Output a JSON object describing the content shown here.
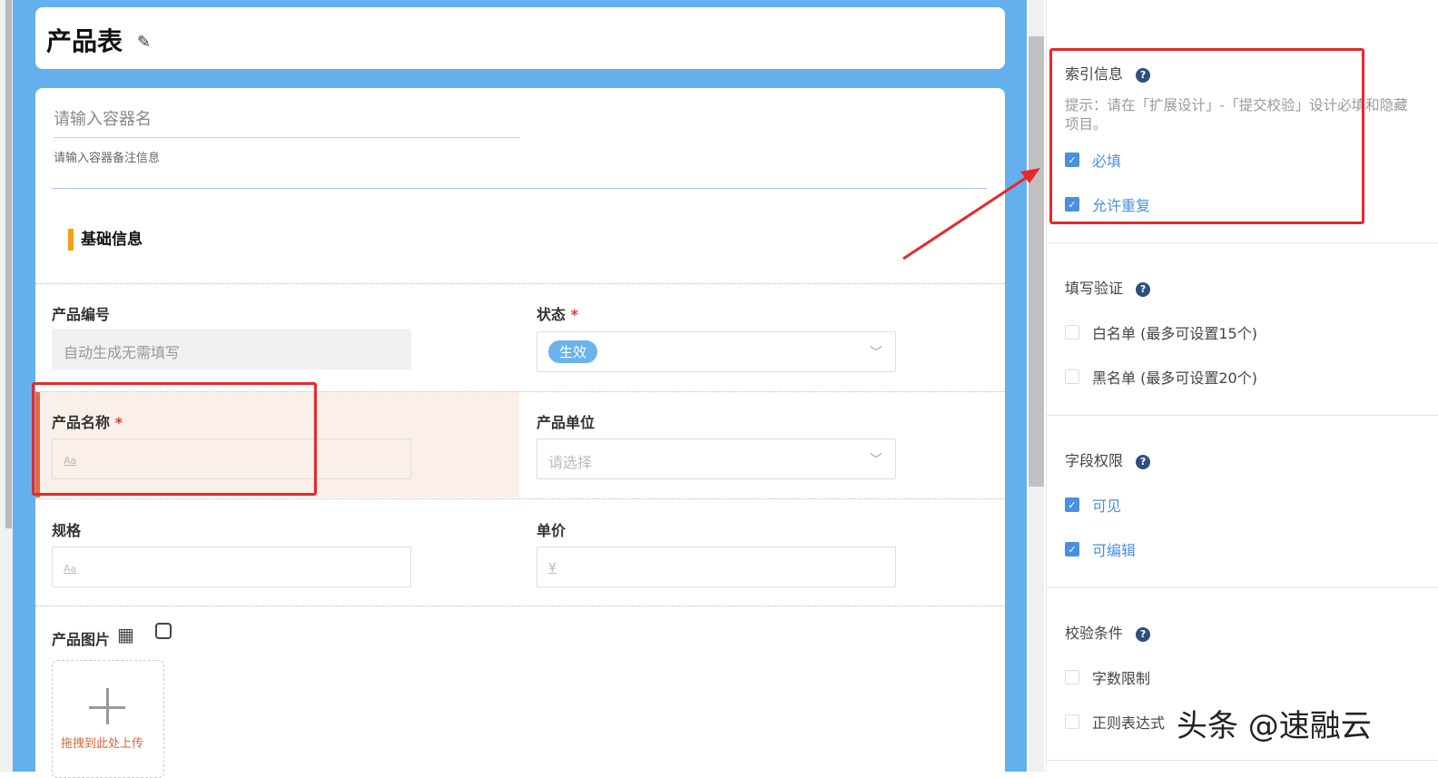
{
  "form": {
    "title": "产品表",
    "container_name_placeholder": "请输入容器名",
    "container_note_placeholder": "请输入容器备注信息",
    "section_title": "基础信息",
    "fields": [
      {
        "label": "产品编号",
        "value": "自动生成无需填写"
      },
      {
        "label": "状态",
        "required": "*",
        "value": "生效"
      },
      {
        "label": "产品名称",
        "required": "*",
        "placeholder": "Aa"
      },
      {
        "label": "产品单位",
        "placeholder": "请选择"
      },
      {
        "label": "规格",
        "placeholder": "Aa"
      },
      {
        "label": "单价",
        "placeholder": "¥"
      },
      {
        "label": "产品图片",
        "upload_text": "拖拽到此处上传"
      }
    ]
  },
  "panel": {
    "index": {
      "title": "索引信息",
      "hint": "提示：请在「扩展设计」-「提交校验」设计必填和隐藏项目。",
      "options": [
        {
          "label": "必填",
          "checked": true
        },
        {
          "label": "允许重复",
          "checked": true
        }
      ]
    },
    "validation": {
      "title": "填写验证",
      "options": [
        {
          "label": "白名单 (最多可设置15个)",
          "checked": false
        },
        {
          "label": "黑名单 (最多可设置20个)",
          "checked": false
        }
      ]
    },
    "permission": {
      "title": "字段权限",
      "options": [
        {
          "label": "可见",
          "checked": true
        },
        {
          "label": "可编辑",
          "checked": true
        }
      ]
    },
    "conditions": {
      "title": "校验条件",
      "options": [
        {
          "label": "字数限制",
          "checked": false
        },
        {
          "label": "正则表达式",
          "checked": false
        }
      ]
    }
  },
  "watermark": "头条 @速融云"
}
